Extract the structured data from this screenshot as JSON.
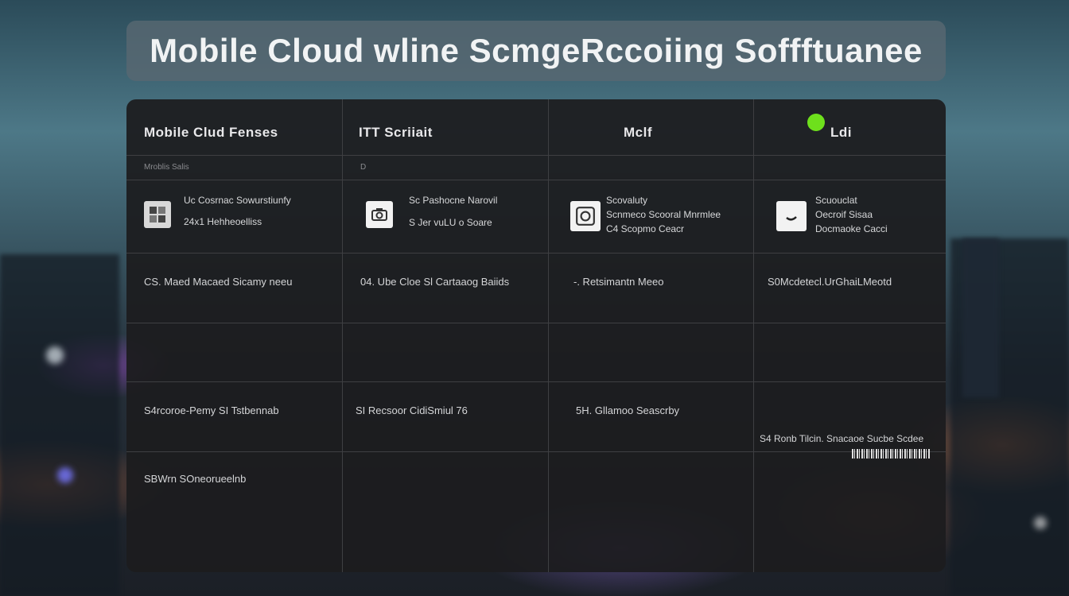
{
  "header": {
    "title": "Mobile Cloud wline ScmgeRccoiing Soffftuanee"
  },
  "table": {
    "columns": [
      {
        "label": "Mobile Clud Fenses",
        "sub": "Mroblis Salis"
      },
      {
        "label": "ITT Scriiait",
        "sub": "D"
      },
      {
        "label": "Mclf",
        "sub": ""
      },
      {
        "label": "Ldi",
        "sub": ""
      }
    ],
    "apps": [
      {
        "line1": "Uc Cosrnac Sowurstiunfy",
        "line2": "24x1 Hehheoelliss",
        "icon": "app-grid-icon"
      },
      {
        "line1": "Sc Pashocne Narovil",
        "line2": "S Jer vuLU o Soare",
        "icon": "camera-icon"
      },
      {
        "line1": "Scovaluty",
        "line2": "Scnmeco Scooral Mnrmlee",
        "line3": "C4 Scopmo Ceacr",
        "icon": "cloud-sync-icon"
      },
      {
        "line1": "Scuouclat",
        "line2": "Oecroif Sisaa",
        "line3": "Docmaoke Cacci",
        "icon": "check-icon"
      }
    ],
    "row3": [
      "CS. Maed Macaed Sicamy neeu",
      "04. Ube Cloe Sl Cartaaog Baiids",
      "-. Retsimantn Meeo",
      "S0Mcdetecl.UrGhaiLMeotd"
    ],
    "row5": [
      "S4rcoroe-Pemy SI Tstbennab",
      "SI Recsoor CidiSmiul 76",
      "5H. Gllamoo Seascrby",
      ""
    ],
    "row6": [
      "SBWrn SOneorueelnb"
    ],
    "footnote": "S4 Ronb Tilcin. Snacaoe Sucbe Scdee"
  },
  "colors": {
    "accent_status": "#6ee01c",
    "panel_bg": "#1c1c1e",
    "title_bg": "#586872"
  }
}
